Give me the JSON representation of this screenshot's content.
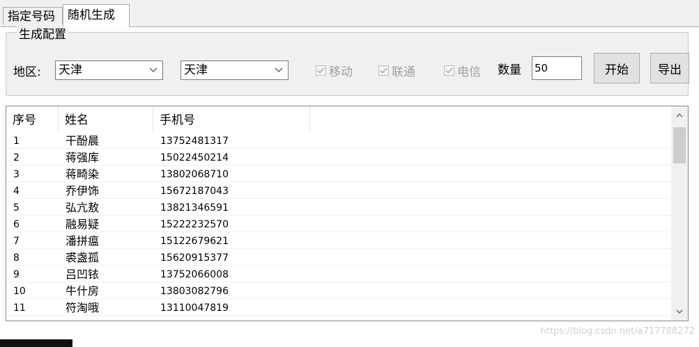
{
  "tabs": [
    "指定号码",
    "随机生成"
  ],
  "group": {
    "title": "生成配置",
    "region_label": "地区:",
    "combo1": "天津",
    "combo2": "天津",
    "chk_mobile": "移动",
    "chk_unicom": "联通",
    "chk_telecom": "电信",
    "count_label": "数量",
    "count_value": "50",
    "start_label": "开始",
    "export_label": "导出"
  },
  "list": {
    "columns": [
      "序号",
      "姓名",
      "手机号"
    ],
    "rows": [
      {
        "seq": "1",
        "name": "干酚晨",
        "phone": "13752481317"
      },
      {
        "seq": "2",
        "name": "蒋强库",
        "phone": "15022450214"
      },
      {
        "seq": "3",
        "name": "蒋畸染",
        "phone": "13802068710"
      },
      {
        "seq": "4",
        "name": "乔伊饰",
        "phone": "15672187043"
      },
      {
        "seq": "5",
        "name": "弘亢敖",
        "phone": "13821346591"
      },
      {
        "seq": "6",
        "name": "融易疑",
        "phone": "15222232570"
      },
      {
        "seq": "7",
        "name": "潘拼瘟",
        "phone": "15122679621"
      },
      {
        "seq": "8",
        "name": "裘盏孤",
        "phone": "15620915377"
      },
      {
        "seq": "9",
        "name": "吕凹铱",
        "phone": "13752066008"
      },
      {
        "seq": "10",
        "name": "牛什房",
        "phone": "13803082796"
      },
      {
        "seq": "11",
        "name": "符淘哦",
        "phone": "13110047819"
      }
    ]
  },
  "watermark": "https://blog.csdn.net/a717788272"
}
